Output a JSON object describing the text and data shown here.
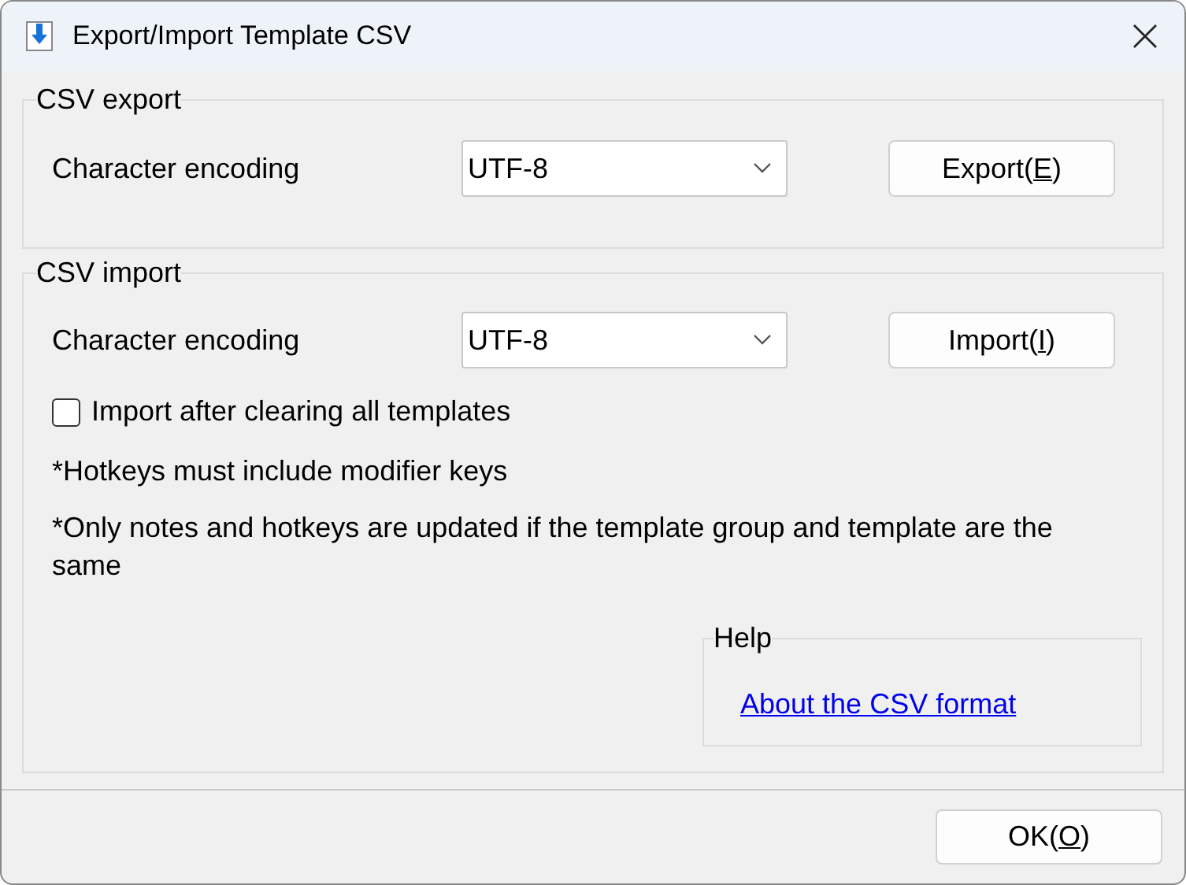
{
  "window": {
    "title": "Export/Import Template CSV"
  },
  "export_group": {
    "title": "CSV export",
    "encoding_label": "Character encoding",
    "encoding_value": "UTF-8",
    "button": {
      "before": "Export(",
      "key": "E",
      "after": ")"
    }
  },
  "import_group": {
    "title": "CSV import",
    "encoding_label": "Character encoding",
    "encoding_value": "UTF-8",
    "button": {
      "before": "Import(",
      "key": "I",
      "after": ")"
    },
    "clear_checkbox": {
      "label": "Import after clearing all templates",
      "checked": false
    },
    "notes": [
      "*Hotkeys must include modifier keys",
      "*Only notes and hotkeys are updated if the template group and template are the same"
    ],
    "help": {
      "title": "Help",
      "link": "About the CSV format"
    }
  },
  "ok_button": {
    "before": "OK(",
    "key": "O",
    "after": ")"
  }
}
